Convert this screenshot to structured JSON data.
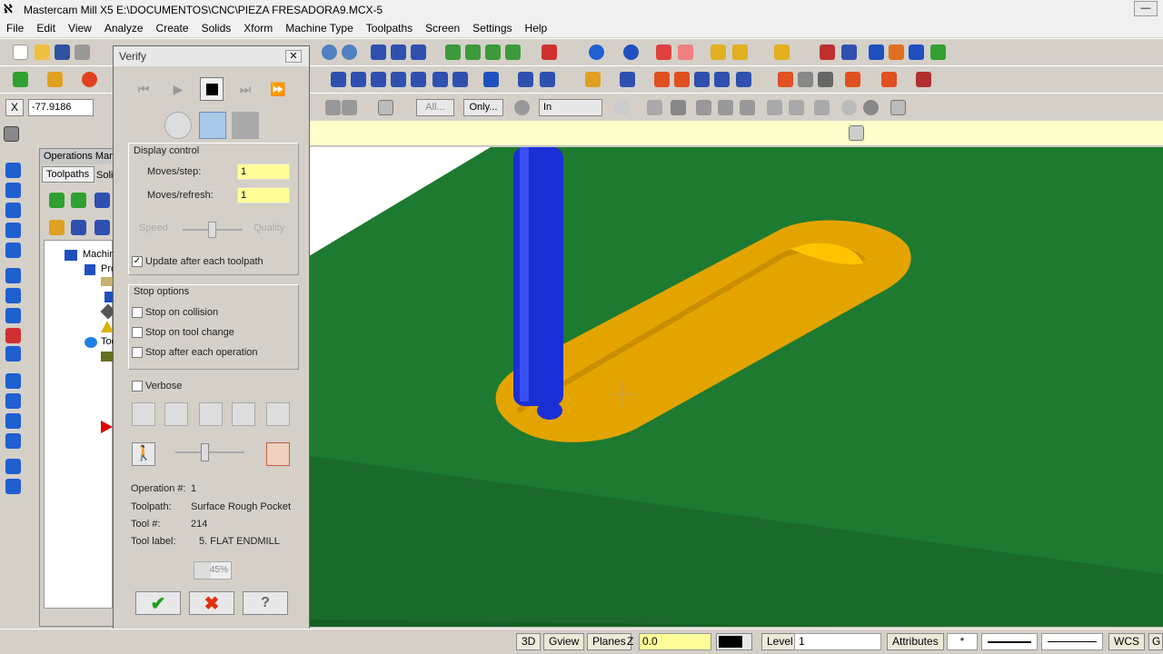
{
  "window": {
    "title": "Mastercam Mill X5  E:\\DOCUMENTOS\\CNC\\PIEZA FRESADORA9.MCX-5"
  },
  "menu": [
    "File",
    "Edit",
    "View",
    "Analyze",
    "Create",
    "Solids",
    "Xform",
    "Machine Type",
    "Toolpaths",
    "Screen",
    "Settings",
    "Help"
  ],
  "coord": {
    "value": "-77.9186",
    "axis": "X"
  },
  "toolbar3": {
    "all_label": "All...",
    "only_label": "Only...",
    "in_value": "In"
  },
  "ops_manager": {
    "title": "Operations Mana",
    "tab1": "Toolpaths",
    "tab2": "Soli",
    "machine": "Machin",
    "prop": "Pro",
    "tool": "Too"
  },
  "verify": {
    "title": "Verify",
    "display_control": "Display control",
    "moves_step_label": "Moves/step:",
    "moves_step_value": "1",
    "moves_refresh_label": "Moves/refresh:",
    "moves_refresh_value": "1",
    "speed_label": "Speed",
    "quality_label": "Quality",
    "update_label": "Update after each toolpath",
    "update_checked": true,
    "stop_options": "Stop options",
    "stop_collision": "Stop on collision",
    "stop_tool_change": "Stop on tool change",
    "stop_each_op": "Stop after each operation",
    "verbose": "Verbose",
    "info": {
      "op_label": "Operation #:",
      "op_value": "1",
      "toolpath_label": "Toolpath:",
      "toolpath_value": "Surface Rough Pocket",
      "tool_label": "Tool #:",
      "tool_value": "214",
      "toollabel_label": "Tool label:",
      "toollabel_value": "5. FLAT ENDMILL"
    },
    "progress": "45%",
    "progress_fraction": 0.45
  },
  "status": {
    "btn3d": "3D",
    "gview": "Gview",
    "planes": "Planes",
    "z_label": "Z",
    "z_value": "0.0",
    "level_label": "Level",
    "level_value": "1",
    "attributes": "Attributes",
    "wcs": "WCS",
    "g": "G"
  },
  "colors": {
    "stock": "#1e7a30",
    "part": "#e3a400",
    "tool": "#1a2fd6",
    "field": "#ffff99"
  }
}
